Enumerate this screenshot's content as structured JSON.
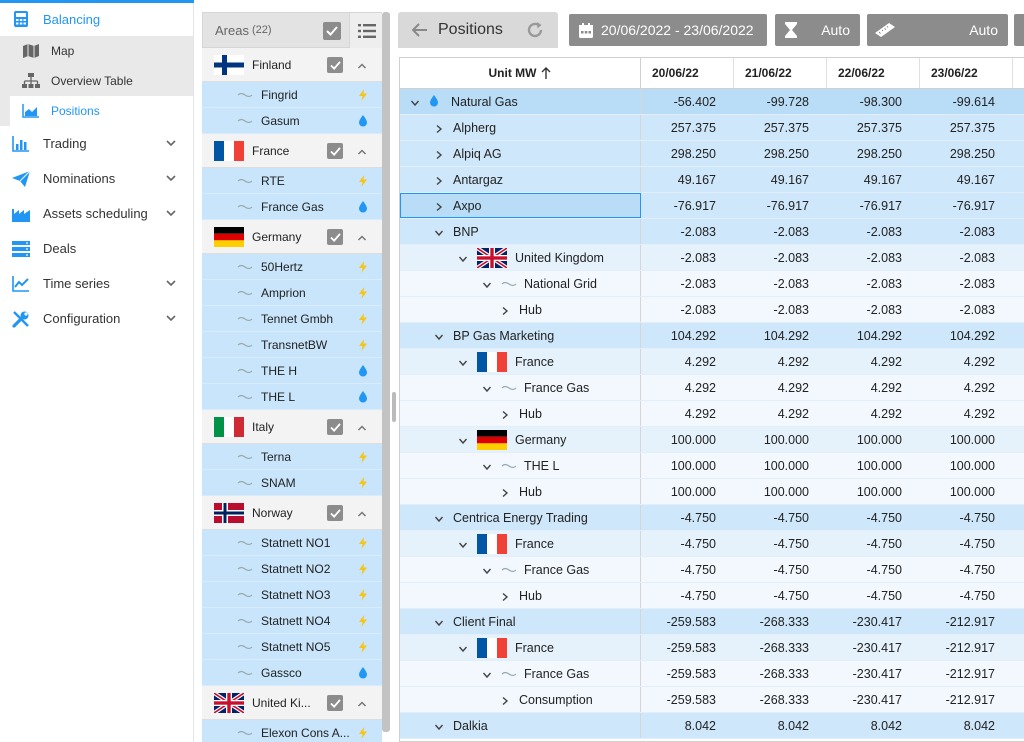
{
  "nav": {
    "brand": {
      "label": "Balancing",
      "icon": "calculator-icon"
    },
    "sub_items": [
      {
        "label": "Map",
        "icon": "map-icon"
      },
      {
        "label": "Overview Table",
        "icon": "sitemap-icon"
      },
      {
        "label": "Positions",
        "icon": "area-chart-icon"
      }
    ],
    "items": [
      {
        "label": "Trading",
        "icon": "bar-chart-icon"
      },
      {
        "label": "Nominations",
        "icon": "paper-plane-icon"
      },
      {
        "label": "Assets scheduling",
        "icon": "factory-icon"
      },
      {
        "label": "Deals",
        "icon": "server-icon"
      },
      {
        "label": "Time series",
        "icon": "line-chart-icon"
      },
      {
        "label": "Configuration",
        "icon": "tools-icon"
      }
    ],
    "accent": "#2196f3"
  },
  "areas": {
    "title": "Areas",
    "count": "(22)",
    "groups": [
      {
        "country": "Finland",
        "flag": "finland-flag",
        "tsos": [
          {
            "name": "Fingrid",
            "type": "power"
          },
          {
            "name": "Gasum",
            "type": "gas"
          }
        ]
      },
      {
        "country": "France",
        "flag": "france-flag",
        "tsos": [
          {
            "name": "RTE",
            "type": "power"
          },
          {
            "name": "France Gas",
            "type": "gas"
          }
        ]
      },
      {
        "country": "Germany",
        "flag": "germany-flag",
        "tsos": [
          {
            "name": "50Hertz",
            "type": "power"
          },
          {
            "name": "Amprion",
            "type": "power"
          },
          {
            "name": "Tennet Gmbh",
            "type": "power"
          },
          {
            "name": "TransnetBW",
            "type": "power"
          },
          {
            "name": "THE H",
            "type": "gas"
          },
          {
            "name": "THE L",
            "type": "gas"
          }
        ]
      },
      {
        "country": "Italy",
        "flag": "italy-flag",
        "tsos": [
          {
            "name": "Terna",
            "type": "power"
          },
          {
            "name": "SNAM",
            "type": "power"
          }
        ]
      },
      {
        "country": "Norway",
        "flag": "norway-flag",
        "tsos": [
          {
            "name": "Statnett NO1",
            "type": "power"
          },
          {
            "name": "Statnett NO2",
            "type": "power"
          },
          {
            "name": "Statnett NO3",
            "type": "power"
          },
          {
            "name": "Statnett NO4",
            "type": "power"
          },
          {
            "name": "Statnett NO5",
            "type": "power"
          },
          {
            "name": "Gassco",
            "type": "gas"
          }
        ]
      },
      {
        "country": "United Ki...",
        "flag": "uk-flag",
        "tsos": [
          {
            "name": "Elexon Cons A...",
            "type": "power"
          }
        ]
      }
    ],
    "power_color": "#f5c518",
    "gas_color": "#2196f3"
  },
  "toolbar": {
    "tab_label": "Positions",
    "date_range": "20/06/2022 - 23/06/2022",
    "granularity": "Auto",
    "unit_scale": "Auto"
  },
  "grid": {
    "unit_header": "Unit MW",
    "sort": "ascending",
    "dates": [
      "20/06/22",
      "21/06/22",
      "22/06/22",
      "23/06/22"
    ],
    "rows": [
      {
        "label": "Natural Gas",
        "level": 0,
        "expanded": true,
        "icon": "gas-drop-icon",
        "values": [
          "-56.402",
          "-99.728",
          "-98.300",
          "-99.614"
        ]
      },
      {
        "label": "Alpherg",
        "level": 1,
        "expanded": false,
        "values": [
          "257.375",
          "257.375",
          "257.375",
          "257.375"
        ]
      },
      {
        "label": "Alpiq AG",
        "level": 1,
        "expanded": false,
        "values": [
          "298.250",
          "298.250",
          "298.250",
          "298.250"
        ]
      },
      {
        "label": "Antargaz",
        "level": 1,
        "expanded": false,
        "values": [
          "49.167",
          "49.167",
          "49.167",
          "49.167"
        ]
      },
      {
        "label": "Axpo",
        "level": 1,
        "expanded": false,
        "selected": true,
        "values": [
          "-76.917",
          "-76.917",
          "-76.917",
          "-76.917"
        ]
      },
      {
        "label": "BNP",
        "level": 1,
        "expanded": true,
        "values": [
          "-2.083",
          "-2.083",
          "-2.083",
          "-2.083"
        ]
      },
      {
        "label": "United Kingdom",
        "level": 2,
        "expanded": true,
        "flag": "uk-flag",
        "values": [
          "-2.083",
          "-2.083",
          "-2.083",
          "-2.083"
        ]
      },
      {
        "label": "National Grid",
        "level": 3,
        "expanded": true,
        "icon": "national-grid-logo",
        "values": [
          "-2.083",
          "-2.083",
          "-2.083",
          "-2.083"
        ]
      },
      {
        "label": "Hub",
        "level": 4,
        "expanded": false,
        "values": [
          "-2.083",
          "-2.083",
          "-2.083",
          "-2.083"
        ]
      },
      {
        "label": "BP Gas Marketing",
        "level": 1,
        "expanded": true,
        "values": [
          "104.292",
          "104.292",
          "104.292",
          "104.292"
        ]
      },
      {
        "label": "France",
        "level": 2,
        "expanded": true,
        "flag": "france-flag",
        "values": [
          "4.292",
          "4.292",
          "4.292",
          "4.292"
        ]
      },
      {
        "label": "France Gas",
        "level": 3,
        "expanded": true,
        "icon": "france-gas-logo",
        "values": [
          "4.292",
          "4.292",
          "4.292",
          "4.292"
        ]
      },
      {
        "label": "Hub",
        "level": 4,
        "expanded": false,
        "values": [
          "4.292",
          "4.292",
          "4.292",
          "4.292"
        ]
      },
      {
        "label": "Germany",
        "level": 2,
        "expanded": true,
        "flag": "germany-flag",
        "values": [
          "100.000",
          "100.000",
          "100.000",
          "100.000"
        ]
      },
      {
        "label": "THE L",
        "level": 3,
        "expanded": true,
        "icon": "the-logo",
        "values": [
          "100.000",
          "100.000",
          "100.000",
          "100.000"
        ]
      },
      {
        "label": "Hub",
        "level": 4,
        "expanded": false,
        "values": [
          "100.000",
          "100.000",
          "100.000",
          "100.000"
        ]
      },
      {
        "label": "Centrica Energy Trading",
        "level": 1,
        "expanded": true,
        "values": [
          "-4.750",
          "-4.750",
          "-4.750",
          "-4.750"
        ]
      },
      {
        "label": "France",
        "level": 2,
        "expanded": true,
        "flag": "france-flag",
        "values": [
          "-4.750",
          "-4.750",
          "-4.750",
          "-4.750"
        ]
      },
      {
        "label": "France Gas",
        "level": 3,
        "expanded": true,
        "icon": "france-gas-logo",
        "values": [
          "-4.750",
          "-4.750",
          "-4.750",
          "-4.750"
        ]
      },
      {
        "label": "Hub",
        "level": 4,
        "expanded": false,
        "values": [
          "-4.750",
          "-4.750",
          "-4.750",
          "-4.750"
        ]
      },
      {
        "label": "Client Final",
        "level": 1,
        "expanded": true,
        "values": [
          "-259.583",
          "-268.333",
          "-230.417",
          "-212.917"
        ]
      },
      {
        "label": "France",
        "level": 2,
        "expanded": true,
        "flag": "france-flag",
        "values": [
          "-259.583",
          "-268.333",
          "-230.417",
          "-212.917"
        ]
      },
      {
        "label": "France Gas",
        "level": 3,
        "expanded": true,
        "icon": "france-gas-logo",
        "values": [
          "-259.583",
          "-268.333",
          "-230.417",
          "-212.917"
        ]
      },
      {
        "label": "Consumption",
        "level": 4,
        "expanded": false,
        "values": [
          "-259.583",
          "-268.333",
          "-230.417",
          "-212.917"
        ]
      },
      {
        "label": "Dalkia",
        "level": 1,
        "expanded": true,
        "values": [
          "8.042",
          "8.042",
          "8.042",
          "8.042"
        ]
      }
    ]
  }
}
